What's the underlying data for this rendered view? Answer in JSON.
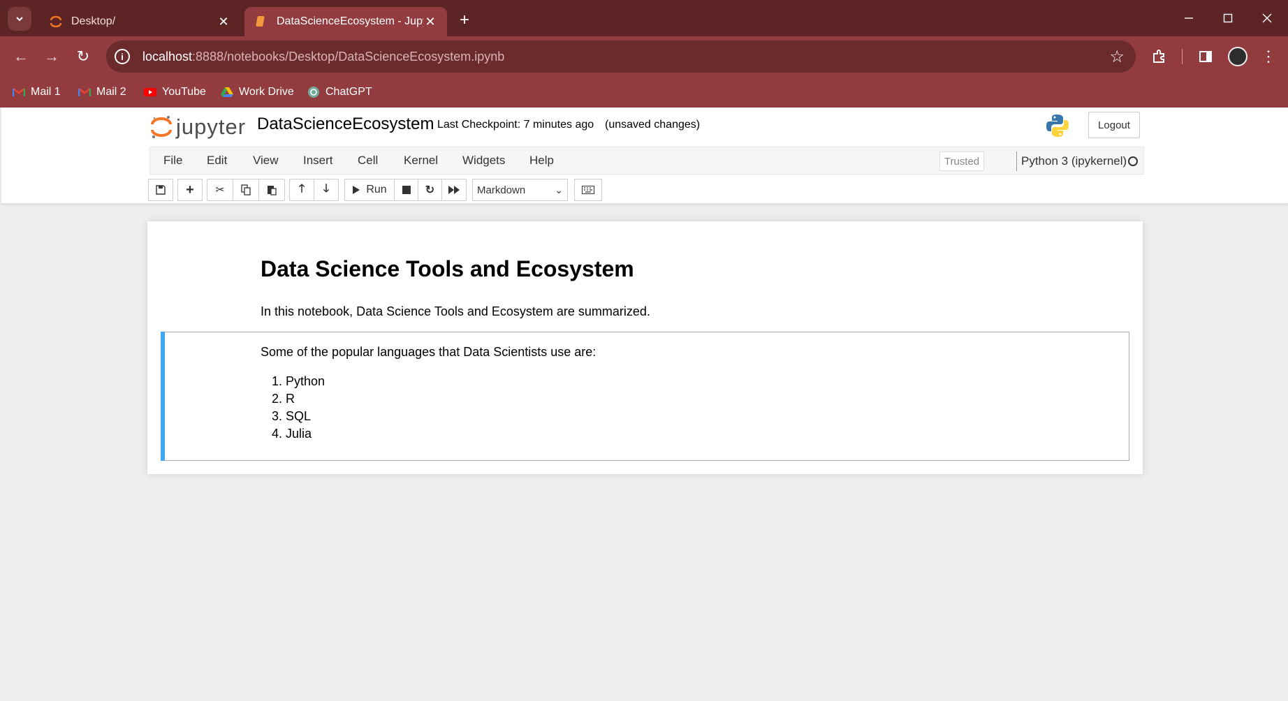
{
  "browser": {
    "tabs": [
      {
        "title": "Desktop/",
        "active": false
      },
      {
        "title": "DataScienceEcosystem - Jupyter",
        "active": true
      }
    ],
    "url_host": "localhost",
    "url_path": ":8888/notebooks/Desktop/DataScienceEcosystem.ipynb",
    "bookmarks": [
      "Mail 1",
      "Mail 2",
      "YouTube",
      "Work Drive",
      "ChatGPT"
    ]
  },
  "jupyter": {
    "logo_text": "jupyter",
    "notebook_name": "DataScienceEcosystem",
    "checkpoint": "Last Checkpoint: 7 minutes ago",
    "unsaved": "(unsaved changes)",
    "logout_label": "Logout",
    "menu": [
      "File",
      "Edit",
      "View",
      "Insert",
      "Cell",
      "Kernel",
      "Widgets",
      "Help"
    ],
    "trusted": "Trusted",
    "kernel": "Python 3 (ipykernel)",
    "run_label": "Run",
    "cell_type": "Markdown"
  },
  "notebook": {
    "heading": "Data Science Tools and Ecosystem",
    "intro": "In this notebook, Data Science Tools and Ecosystem are summarized.",
    "languages_intro": "Some of the popular languages that Data Scientists use are:",
    "languages": [
      "1. Python",
      "2. R",
      "3. SQL",
      "4. Julia"
    ]
  },
  "colors": {
    "tabstrip": "#5d2426",
    "toolbar": "#923c3f",
    "cell_selected_bar": "#42a5f5",
    "jupyter_orange": "#f37726"
  }
}
